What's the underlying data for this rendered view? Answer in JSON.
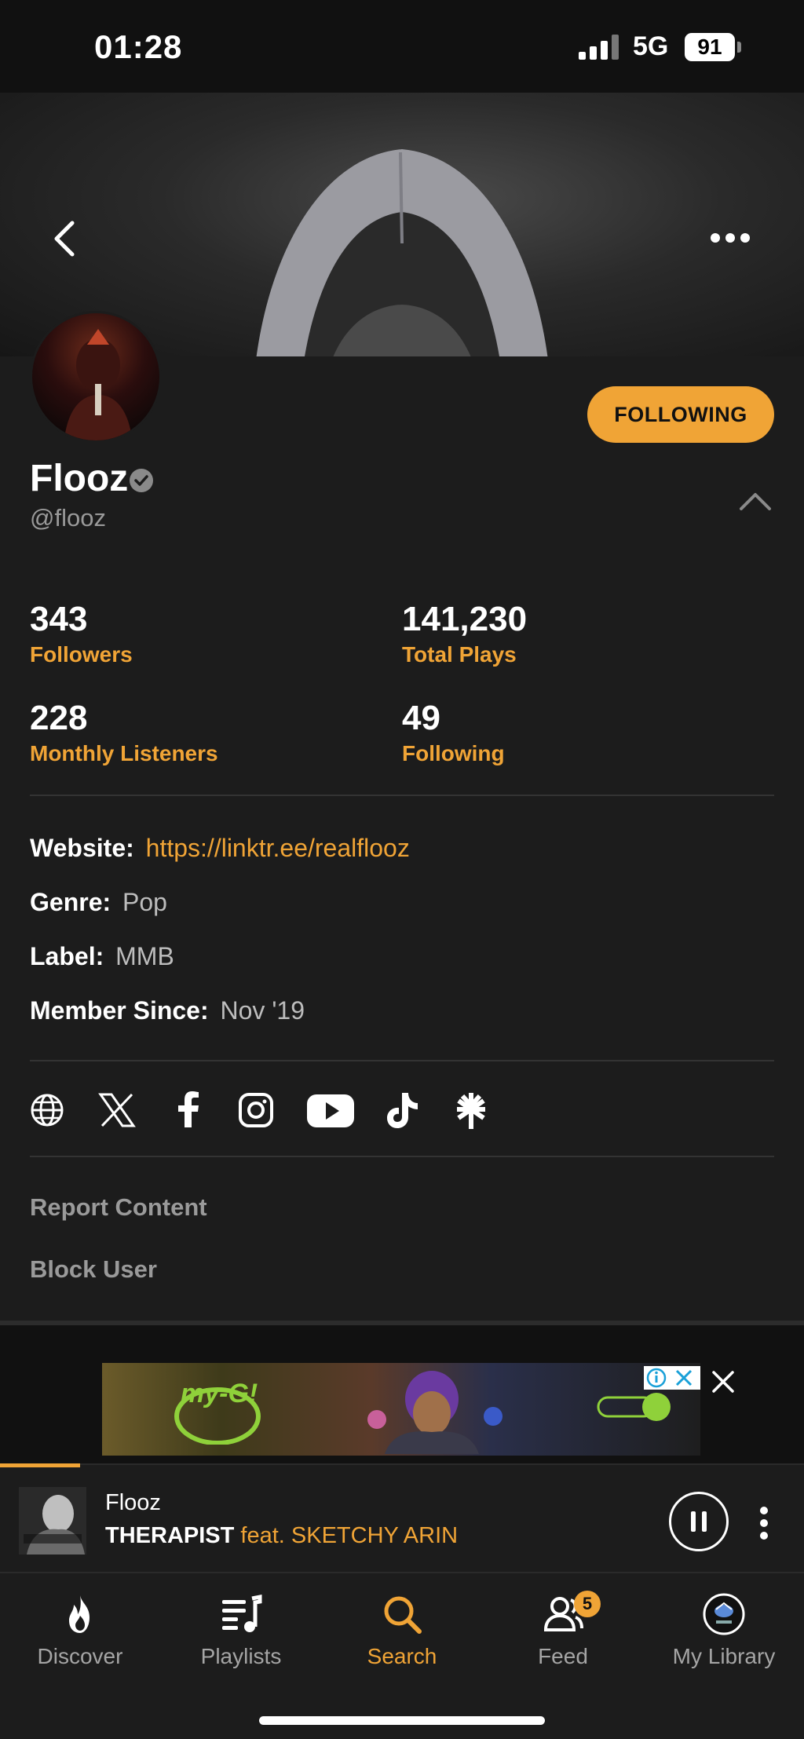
{
  "status_bar": {
    "time": "01:28",
    "network": "5G",
    "battery": "91"
  },
  "profile": {
    "name": "Flooz",
    "handle": "@flooz",
    "follow_label": "FOLLOWING"
  },
  "stats": [
    {
      "value": "343",
      "label": "Followers"
    },
    {
      "value": "141,230",
      "label": "Total Plays"
    },
    {
      "value": "228",
      "label": "Monthly Listeners"
    },
    {
      "value": "49",
      "label": "Following"
    }
  ],
  "info": {
    "website_key": "Website:",
    "website_val": "https://linktr.ee/realflooz",
    "genre_key": "Genre:",
    "genre_val": "Pop",
    "label_key": "Label:",
    "label_val": "MMB",
    "member_key": "Member Since:",
    "member_val": "Nov '19"
  },
  "social_icons": [
    "globe-icon",
    "x-icon",
    "facebook-icon",
    "instagram-icon",
    "youtube-icon",
    "tiktok-icon",
    "linktree-icon"
  ],
  "actions": {
    "report": "Report Content",
    "block": "Block User"
  },
  "now_playing": {
    "artist": "Flooz",
    "title": "THERAPIST",
    "feat": " feat. SKETCHY ARIN",
    "progress": 0.1
  },
  "tabs": [
    {
      "label": "Discover",
      "icon": "flame-icon"
    },
    {
      "label": "Playlists",
      "icon": "playlist-icon"
    },
    {
      "label": "Search",
      "icon": "search-icon"
    },
    {
      "label": "Feed",
      "icon": "feed-icon",
      "badge": "5"
    },
    {
      "label": "My Library",
      "icon": "library-avatar-icon"
    }
  ],
  "colors": {
    "accent": "#f0a436",
    "background": "#1c1c1c"
  }
}
